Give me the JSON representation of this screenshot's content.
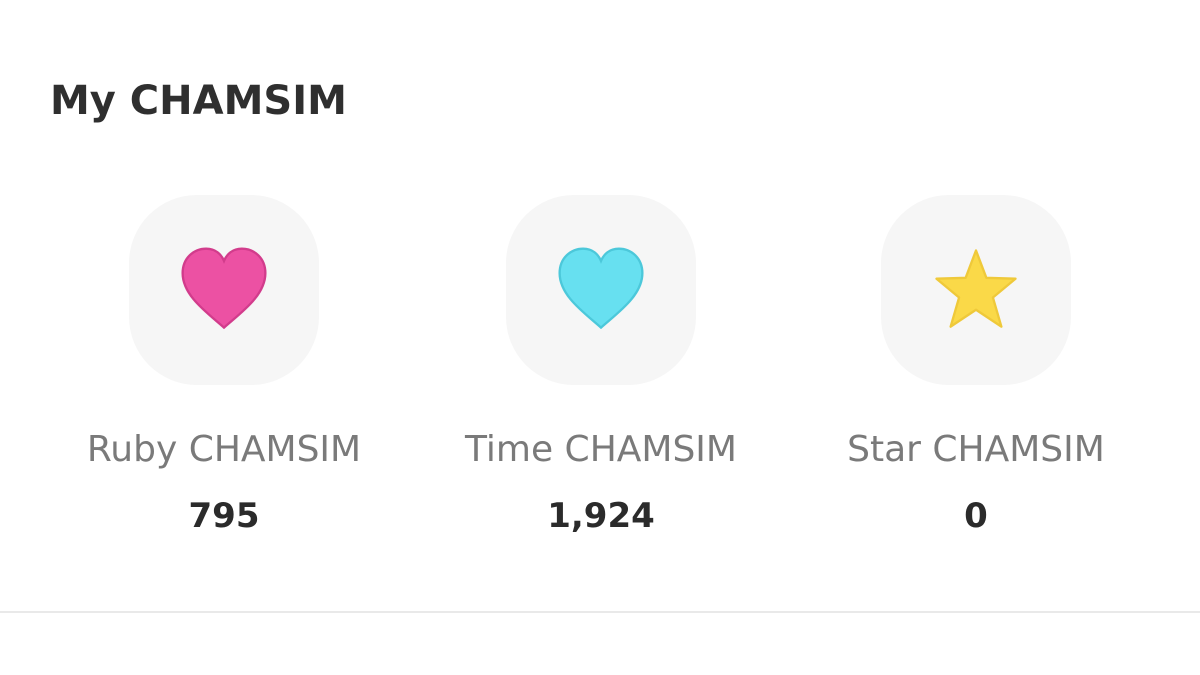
{
  "section": {
    "title": "My CHAMSIM"
  },
  "items": [
    {
      "label": "Ruby CHAMSIM",
      "value": "795",
      "icon": "heart-icon",
      "color": "#ec51a3",
      "stroke": "#d23c8c"
    },
    {
      "label": "Time CHAMSIM",
      "value": "1,924",
      "icon": "heart-icon",
      "color": "#67e0f0",
      "stroke": "#4cc8da"
    },
    {
      "label": "Star CHAMSIM",
      "value": "0",
      "icon": "star-icon",
      "color": "#fad948",
      "stroke": "#efc93a"
    }
  ]
}
